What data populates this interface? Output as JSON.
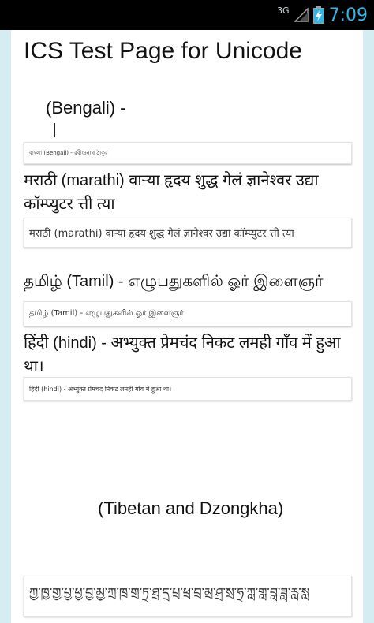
{
  "status_bar": {
    "network": "3G",
    "time": "7:09",
    "accent_color": "#33b5e5"
  },
  "page": {
    "title": "ICS Test Page for Unicode",
    "bengali": {
      "label": "(Bengali) -",
      "image_text": "বাংলা (Bengali) - রবীন্দ্রনাথ ঠাকুর"
    },
    "marathi": {
      "label": "मराठी (marathi) वाऱ्या हृदय शुद्ध गेलं ज्ञानेश्वर उद्या कॉम्प्युटर त्ती त्या",
      "image_text": "मराठी (marathi) वाऱ्या हृदय शुद्ध गेलं ज्ञानेश्वर उद्या कॉम्प्युटर त्ती त्या"
    },
    "tamil": {
      "label": "தமிழ் (Tamil) - எழுபதுகளில் ஓர் இளைஞர்",
      "image_text": "தமிழ் (Tamil) - எழுபதுகளில் ஓர் இளைஞர்"
    },
    "hindi": {
      "label": "हिंदी (hindi) - अभ्युक्त प्रेमचंद निकट लमही गाँव में हुआ था।",
      "image_text": "हिंदी (hindi) - अभ्युक्त प्रेमचंद निकट लमही गाँव में हुआ था।"
    },
    "tibetan": {
      "label": "(Tibetan and Dzongkha)",
      "image_text": "ཀྱ་ཁྱ་གྱ་པྱ་ཕྱ་བྱ་མྱ་ཀྲ་ཁྲ་གྲ་ཏྲ་ཐྲ་དྲ་པྲ་ཕྲ་བྲ་མྲ་ཤྲ་སྲ་ཧྲ་ཀླ་གླ་བླ་ཟླ་རླ་སླ"
    }
  }
}
